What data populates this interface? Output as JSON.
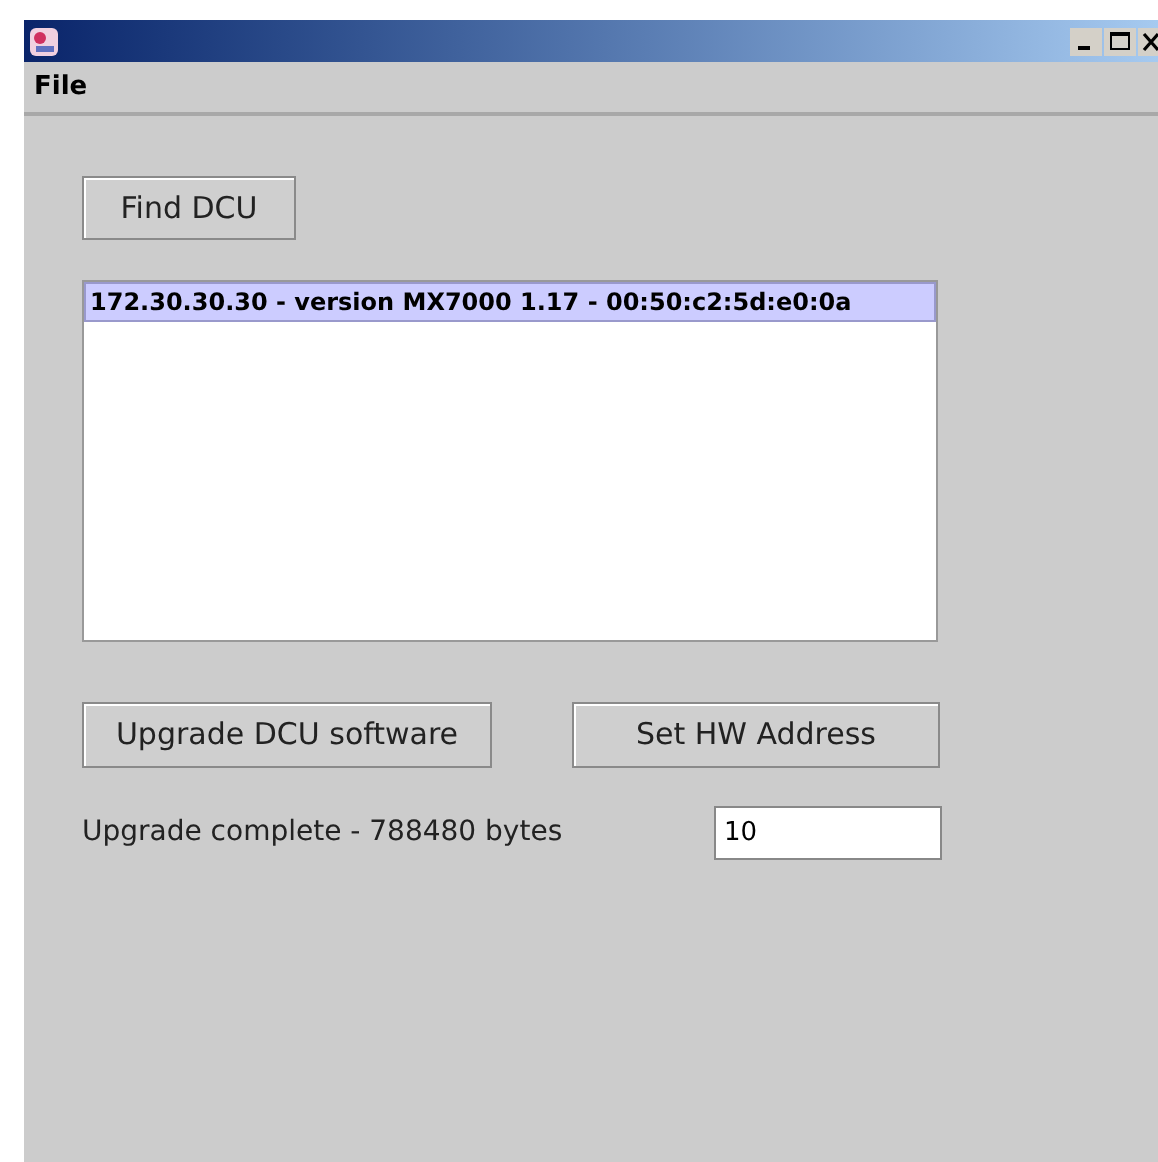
{
  "menu": [
    "File"
  ],
  "find_button": "Find DCU",
  "list": [
    {
      "text": "172.30.30.30 - version MX7000 1.17 - 00:50:c2:5d:e0:0a",
      "selected": true
    }
  ],
  "buttons": [
    "Upgrade DCU software",
    "Set HW Address"
  ],
  "status": "Upgrade complete - 788480 bytes",
  "field": {
    "value": "10"
  }
}
